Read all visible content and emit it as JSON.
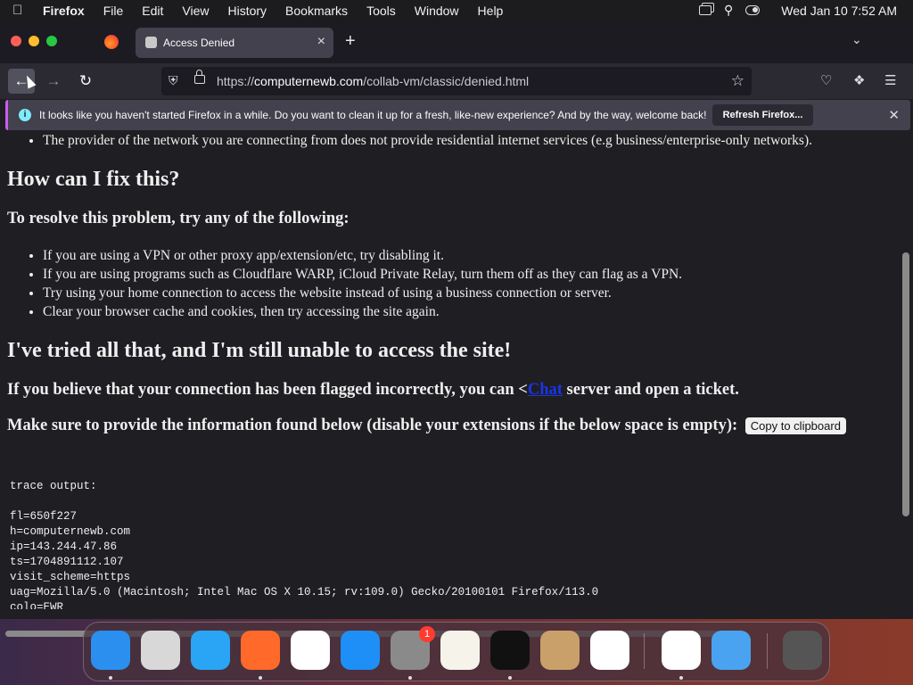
{
  "menubar": {
    "app": "Firefox",
    "items": [
      "File",
      "Edit",
      "View",
      "History",
      "Bookmarks",
      "Tools",
      "Window",
      "Help"
    ],
    "clock": "Wed Jan 10  7:52 AM"
  },
  "tab": {
    "title": "Access Denied"
  },
  "url": {
    "prefix": "https://",
    "domain": "computernewb.com",
    "path": "/collab-vm/classic/denied.html"
  },
  "infobar": {
    "message": "It looks like you haven't started Firefox in a while. Do you want to clean it up for a fresh, like-new experience? And by the way, welcome back!",
    "button": "Refresh Firefox..."
  },
  "page": {
    "top_bullet": "The provider of the network you are connecting from does not provide residential internet services (e.g business/enterprise-only networks).",
    "h_fix": "How can I fix this?",
    "h_resolve": "To resolve this problem, try any of the following:",
    "fixes": [
      "If you are using a VPN or other proxy app/extension/etc, try disabling it.",
      "If you are using programs such as Cloudflare WARP, iCloud Private Relay, turn them off as they can flag as a VPN.",
      "Try using your home connection to access the website instead of using a business connection or server.",
      "Clear your browser cache and cookies, then try accessing the site again."
    ],
    "h_tried": "I've tried all that, and I'm still unable to access the site!",
    "flagged_pre": "If you believe that your connection has been flagged incorrectly, you can <",
    "flagged_link": "Chat",
    "flagged_post": " server and open a ticket.",
    "provide": "Make sure to provide the information found below (disable your extensions if the below space is empty):",
    "copy_button": "Copy to clipboard",
    "trace": "trace output:\n\nfl=650f227\nh=computernewb.com\nip=143.244.47.86\nts=1704891112.107\nvisit_scheme=https\nuag=Mozilla/5.0 (Macintosh; Intel Mac OS X 10.15; rv:109.0) Gecko/20100101 Firefox/113.0\ncolo=EWR\nsliver=none"
  },
  "dock": {
    "badge": "1",
    "apps": [
      "finder-icon",
      "launchpad-icon",
      "safari-icon",
      "firefox-icon",
      "chrome-icon",
      "app-store-icon",
      "system-settings-icon",
      "textedit-icon",
      "terminal-icon",
      "garageband-icon",
      "vscode-icon",
      "visual-studio-icon",
      "weather-icon",
      "trash-icon"
    ],
    "colors": [
      "#2b8ff0",
      "#d8d8d8",
      "#2aa5f5",
      "#ff6a2a",
      "#ffffff",
      "#1e8ff7",
      "#8a8a8a",
      "#f5f3ea",
      "#111111",
      "#c9a06a",
      "#ffffff",
      "#ffffff",
      "#4aa3f0",
      "#555555"
    ]
  }
}
